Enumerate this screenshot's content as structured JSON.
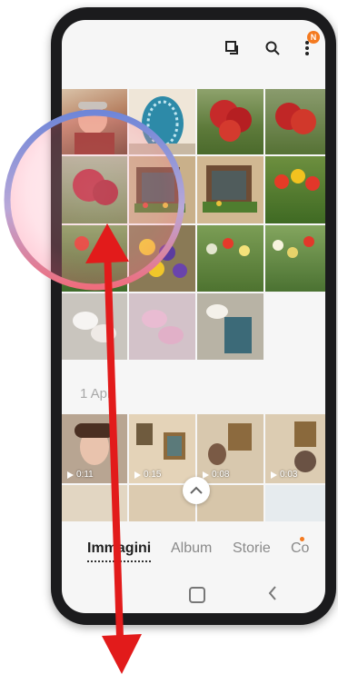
{
  "toolbar": {
    "icons": [
      "select-icon",
      "search-icon",
      "more-icon"
    ],
    "notification_badge": "N"
  },
  "gallery": {
    "date_header": "1 Apr",
    "videos": [
      {
        "duration": "0:11"
      },
      {
        "duration": "0:15"
      },
      {
        "duration": "0:08"
      },
      {
        "duration": "0:03"
      }
    ]
  },
  "tabs": [
    {
      "label": "Immagini",
      "active": true
    },
    {
      "label": "Album",
      "active": false
    },
    {
      "label": "Storie",
      "active": false
    },
    {
      "label": "Co",
      "active": false
    }
  ],
  "colors": {
    "accent": "#f47a20",
    "highlight_circle_stroke": "#7f8fd6",
    "highlight_circle_fill": "#f3a6b4",
    "arrow": "#e21b1b"
  }
}
